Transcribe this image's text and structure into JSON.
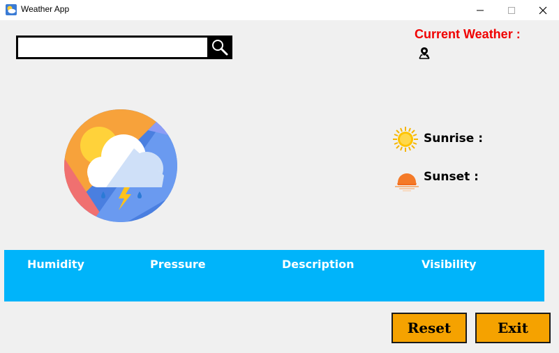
{
  "window": {
    "title": "Weather App",
    "controls": {
      "minimize": "minimize-icon",
      "maximize": "maximize-icon",
      "close": "close-icon"
    }
  },
  "search": {
    "value": "",
    "placeholder": "",
    "button_icon": "search-icon"
  },
  "current_weather": {
    "label": "Current Weather :",
    "location_icon": "location-pin-icon",
    "location_value": ""
  },
  "sun": {
    "sunrise_label": "Sunrise :",
    "sunset_label": "Sunset :"
  },
  "info": {
    "humidity_label": "Humidity",
    "pressure_label": "Pressure",
    "description_label": "Description",
    "visibility_label": "Visibility"
  },
  "buttons": {
    "reset_label": "Reset",
    "exit_label": "Exit"
  },
  "colors": {
    "accent_red": "#f00000",
    "panel_blue": "#00b4fa",
    "button_orange": "#f5a200",
    "background": "#f0f0f0"
  }
}
